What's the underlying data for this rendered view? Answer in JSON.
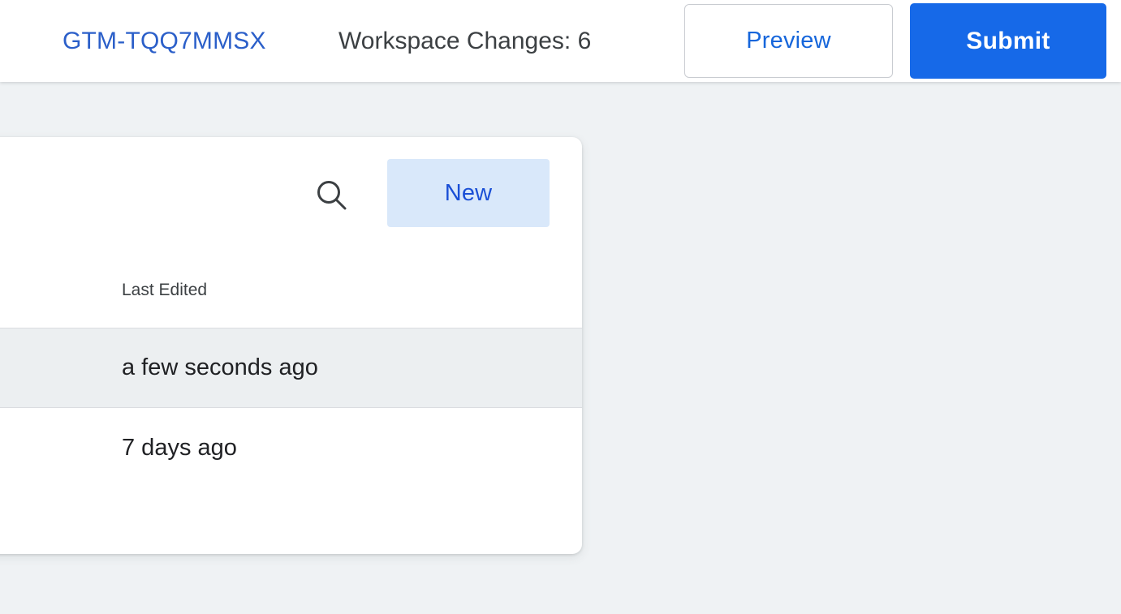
{
  "header": {
    "container_id": "GTM-TQQ7MMSX",
    "workspace_changes": "Workspace Changes: 6",
    "preview_label": "Preview",
    "submit_label": "Submit",
    "container_id_color": "#2b5fc9",
    "submit_bg_color": "#1669e8",
    "preview_text_color": "#1666db"
  },
  "panel": {
    "toolbar": {
      "search_icon": "search-icon",
      "new_label": "New",
      "new_bg_color": "#d9e8fa",
      "new_text_color": "#1a4fd6"
    },
    "table": {
      "columns": [
        "Last Edited"
      ],
      "rows": [
        {
          "last_edited": "a few seconds ago",
          "selected": true
        },
        {
          "last_edited": "7 days ago",
          "selected": false
        }
      ]
    }
  },
  "page": {
    "background_color": "#eff2f4",
    "card_background_color": "#ffffff",
    "selected_row_color": "#eceff1"
  }
}
